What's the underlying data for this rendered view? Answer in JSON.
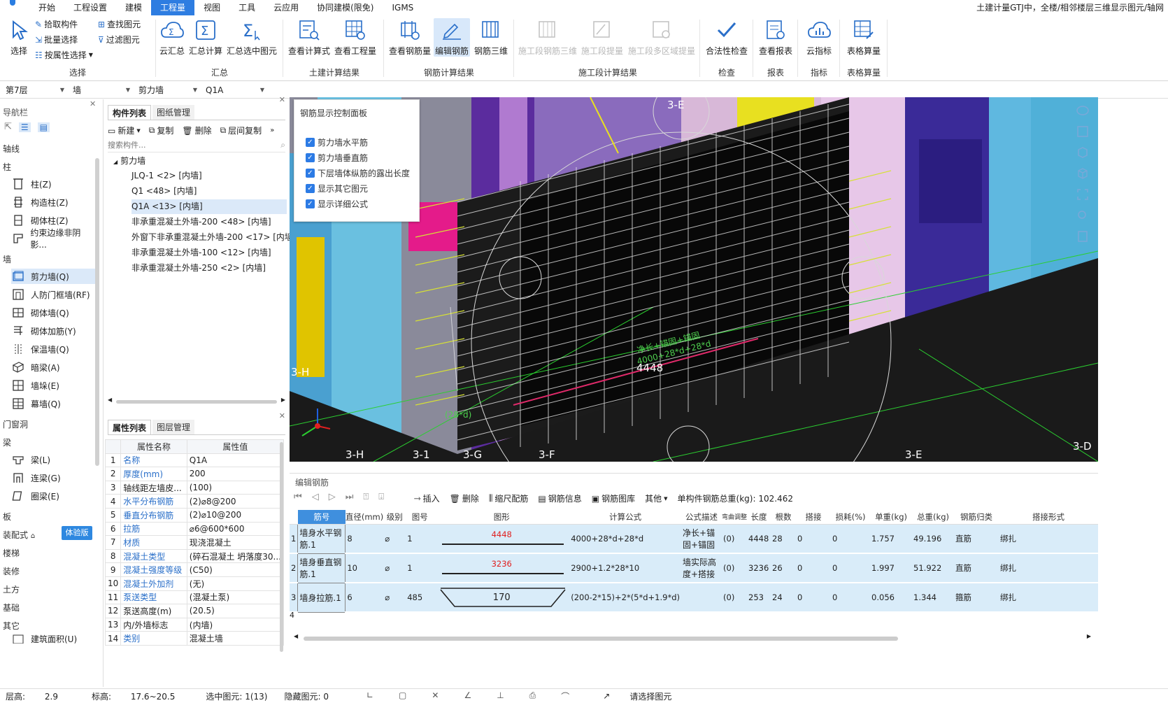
{
  "menu": {
    "items": [
      "开始",
      "工程设置",
      "建模",
      "工程量",
      "视图",
      "工具",
      "云应用",
      "协同建模(限免)",
      "IGMS"
    ],
    "active_index": 3,
    "title": "土建计量GTJ中，全楼/相邻楼层三维显示图元/轴网"
  },
  "ribbon": {
    "select_group": {
      "label": "选择",
      "select": "选择",
      "pick": "拾取构件",
      "batch": "批量选择",
      "by_attr": "按属性选择",
      "find": "查找图元",
      "filter": "过滤图元"
    },
    "sum_group": {
      "label": "汇总",
      "cloud": "云汇总",
      "calc": "汇总计算",
      "selected": "汇总选中图元"
    },
    "civil_group": {
      "label": "土建计算结果",
      "formula": "查看计算式",
      "qty": "查看工程量"
    },
    "rebar_group": {
      "label": "钢筋计算结果",
      "view_qty": "查看钢筋量",
      "edit": "编辑钢筋",
      "rebar3d": "钢筋三维"
    },
    "stage_group": {
      "label": "施工段计算结果",
      "s1": "施工段钢筋三维",
      "s2": "施工段提量",
      "s3": "施工段多区域提量"
    },
    "check_group": {
      "label": "检查",
      "legal": "合法性检查"
    },
    "report_group": {
      "label": "报表",
      "view": "查看报表"
    },
    "index_group": {
      "label": "指标",
      "cloud": "云指标"
    },
    "table_group": {
      "label": "表格算量",
      "table": "表格算量"
    }
  },
  "selectors": {
    "floor": "第7层",
    "type": "墙",
    "sub": "剪力墙",
    "comp": "Q1A"
  },
  "nav": {
    "title": "导航栏",
    "categories": {
      "axis": "轴线",
      "column": "柱",
      "wall": "墙",
      "opening": "门窗洞",
      "beam": "梁",
      "slab": "板",
      "prefab": "装配式",
      "stair": "楼梯",
      "decor": "装修",
      "earth": "土方",
      "found": "基础",
      "other": "其它"
    },
    "trial": "体验版",
    "column_items": [
      "柱(Z)",
      "构造柱(Z)",
      "砌体柱(Z)",
      "约束边缘非阴影..."
    ],
    "wall_items": [
      "剪力墙(Q)",
      "人防门框墙(RF)",
      "砌体墙(Q)",
      "砌体加筋(Y)",
      "保温墙(Q)",
      "暗梁(A)",
      "墙垛(E)",
      "幕墙(Q)"
    ],
    "beam_items": [
      "梁(L)",
      "连梁(G)",
      "圈梁(E)"
    ],
    "other_items": [
      "建筑面积(U)"
    ]
  },
  "complist": {
    "tabs": [
      "构件列表",
      "图纸管理"
    ],
    "tools": [
      "新建",
      "复制",
      "删除",
      "层间复制"
    ],
    "search_placeholder": "搜索构件...",
    "root": "剪力墙",
    "items": [
      "JLQ-1 <2> [内墙]",
      "Q1 <48> [内墙]",
      "Q1A <13> [内墙]",
      "非承重混凝土外墙-200 <48> [内墙]",
      "外窗下非承重混凝土外墙-200 <17> [内墙]",
      "非承重混凝土外墙-100 <12> [内墙]",
      "非承重混凝土外墙-250 <2> [内墙]"
    ],
    "selected_index": 2
  },
  "props": {
    "tabs": [
      "属性列表",
      "图层管理"
    ],
    "headers": [
      "属性名称",
      "属性值"
    ],
    "rows": [
      {
        "n": "1",
        "name": "名称",
        "val": "Q1A",
        "blue": true
      },
      {
        "n": "2",
        "name": "厚度(mm)",
        "val": "200",
        "blue": true
      },
      {
        "n": "3",
        "name": "轴线距左墙皮...",
        "val": "(100)",
        "blue": false
      },
      {
        "n": "4",
        "name": "水平分布钢筋",
        "val": "(2)⌀8@200",
        "blue": true
      },
      {
        "n": "5",
        "name": "垂直分布钢筋",
        "val": "(2)⌀10@200",
        "blue": true
      },
      {
        "n": "6",
        "name": "拉筋",
        "val": "⌀6@600*600",
        "blue": true
      },
      {
        "n": "7",
        "name": "材质",
        "val": "现浇混凝土",
        "blue": true
      },
      {
        "n": "8",
        "name": "混凝土类型",
        "val": "(碎石混凝土 坍落度30...",
        "blue": true
      },
      {
        "n": "9",
        "name": "混凝土强度等级",
        "val": "(C50)",
        "blue": true
      },
      {
        "n": "10",
        "name": "混凝土外加剂",
        "val": "(无)",
        "blue": true
      },
      {
        "n": "11",
        "name": "泵送类型",
        "val": "(混凝土泵)",
        "blue": true
      },
      {
        "n": "12",
        "name": "泵送高度(m)",
        "val": "(20.5)",
        "blue": false
      },
      {
        "n": "13",
        "name": "内/外墙标志",
        "val": "(内墙)",
        "blue": false
      },
      {
        "n": "14",
        "name": "类别",
        "val": "混凝土墙",
        "blue": true
      }
    ]
  },
  "viewport": {
    "panel_title": "钢筋显示控制面板",
    "checks": [
      "剪力墙水平筋",
      "剪力墙垂直筋",
      "下层墙体纵筋的露出长度",
      "显示其它图元",
      "显示详细公式"
    ],
    "axis_labels": [
      "3-E",
      "3-H",
      "3-H",
      "3-1",
      "3-G",
      "3-F",
      "3-E",
      "3-D"
    ],
    "dim_4448": "4448",
    "formula_text": "净长+锚固+锚固",
    "formula_text2": "4000+28*d+28*d",
    "small_label": "(28*d)"
  },
  "editrebar": {
    "title": "编辑钢筋",
    "tools": [
      "插入",
      "删除",
      "缩尺配筋",
      "钢筋信息",
      "钢筋图库",
      "其他"
    ],
    "total": "单构件钢筋总重(kg): 102.462",
    "headers": [
      "筋号",
      "直径(mm)",
      "级别",
      "图号",
      "图形",
      "计算公式",
      "公式描述",
      "弯曲调整",
      "长度",
      "根数",
      "搭接",
      "损耗(%)",
      "单重(kg)",
      "总重(kg)",
      "钢筋归类",
      "搭接形式"
    ],
    "rows": [
      {
        "n": "1",
        "name": "墙身水平钢筋.1",
        "d": "8",
        "grade": "⌀",
        "fig": "1",
        "shape": "4448",
        "formula": "4000+28*d+28*d",
        "desc": "净长+锚固+锚固",
        "adj": "(0)",
        "len": "4448",
        "count": "28",
        "lap": "0",
        "loss": "0",
        "unit": "1.757",
        "total": "49.196",
        "cls": "直筋",
        "lapform": "绑扎"
      },
      {
        "n": "2",
        "name": "墙身垂直钢筋.1",
        "d": "10",
        "grade": "⌀",
        "fig": "1",
        "shape": "3236",
        "formula": "2900+1.2*28*10",
        "desc": "墙实际高度+搭接",
        "adj": "(0)",
        "len": "3236",
        "count": "26",
        "lap": "0",
        "loss": "0",
        "unit": "1.997",
        "total": "51.922",
        "cls": "直筋",
        "lapform": "绑扎"
      },
      {
        "n": "3",
        "name": "墙身拉筋.1",
        "d": "6",
        "grade": "⌀",
        "fig": "485",
        "shape": "170",
        "formula": "(200-2*15)+2*(5*d+1.9*d)",
        "desc": "",
        "adj": "(0)",
        "len": "253",
        "count": "24",
        "lap": "0",
        "loss": "0",
        "unit": "0.056",
        "total": "1.344",
        "cls": "箍筋",
        "lapform": "绑扎"
      }
    ],
    "empty_row": "4"
  },
  "status": {
    "floor_h": "层高:",
    "floor_h_val": "2.9",
    "elev": "标高:",
    "elev_val": "17.6~20.5",
    "selected": "选中图元: 1(13)",
    "hidden": "隐藏图元: 0",
    "prompt": "请选择图元"
  }
}
